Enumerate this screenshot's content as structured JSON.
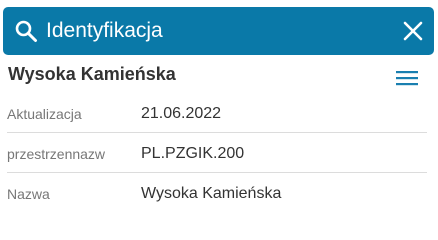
{
  "header": {
    "title": "Identyfikacja",
    "background": "#0a79a8"
  },
  "feature": {
    "title": "Wysoka Kamieńska"
  },
  "attributes": [
    {
      "key": "Aktualizacja",
      "value": "21.06.2022"
    },
    {
      "key": "przestrzennazw",
      "value": "PL.PZGIK.200"
    },
    {
      "key": "Nazwa",
      "value": "Wysoka Kamieńska"
    }
  ],
  "icons": {
    "search": "search-icon",
    "close": "close-icon",
    "menu": "hamburger-menu-icon"
  },
  "colors": {
    "accent": "#0a79a8",
    "menu_icon": "#1a7fb0"
  }
}
